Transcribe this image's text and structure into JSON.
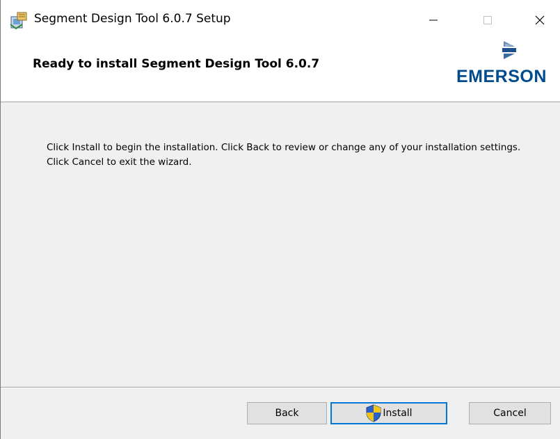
{
  "window": {
    "title": "Segment Design Tool 6.0.7 Setup",
    "icon": "installer-icon"
  },
  "caption_buttons": {
    "minimize": "minimize-icon",
    "maximize": "maximize-icon",
    "close": "close-icon"
  },
  "banner": {
    "title": "Ready to install Segment Design Tool 6.0.7",
    "logo_text": "EMERSON",
    "logo_color": "#004b8d"
  },
  "body": {
    "text": "Click Install to begin the installation. Click Back to review or change any of your installation settings. Click Cancel to exit the wizard."
  },
  "buttons": {
    "back": "Back",
    "install": "Install",
    "cancel": "Cancel"
  },
  "colors": {
    "focus_border": "#0078d7",
    "dialog_bg": "#f0f0f0",
    "button_bg": "#e1e1e1"
  }
}
